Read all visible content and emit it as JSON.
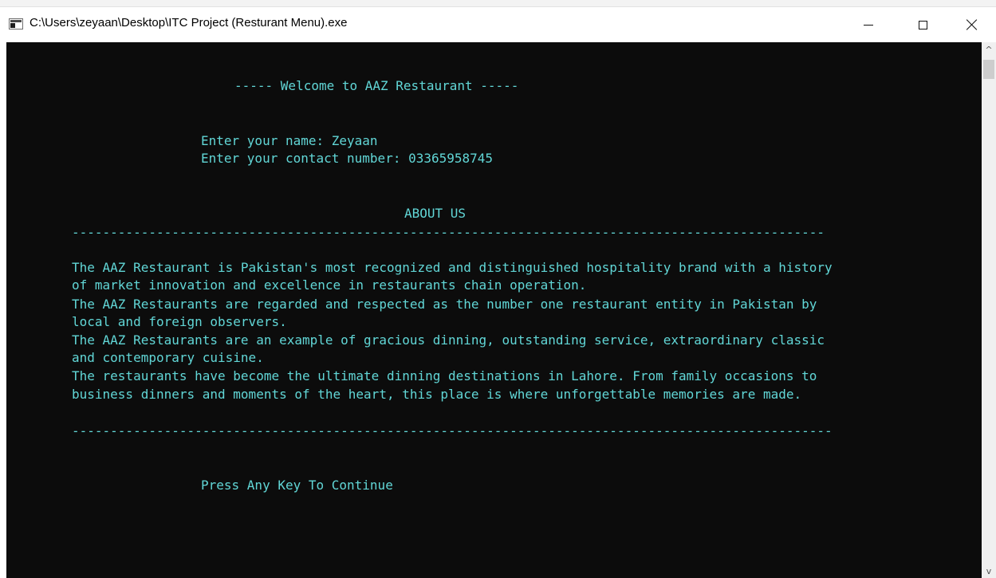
{
  "window": {
    "title": "C:\\Users\\zeyaan\\Desktop\\ITC Project (Resturant Menu).exe"
  },
  "console": {
    "text_color": "#61d6d6",
    "background": "#0c0c0c",
    "welcome": "----- Welcome to AAZ Restaurant -----",
    "name_prompt": "Enter your name: Zeyaan",
    "contact_prompt": "Enter your contact number: 03365958745",
    "about_heading": "ABOUT US",
    "divider_top": "--------------------------------------------------------------------------------------------------",
    "about_lines": [
      "The AAZ Restaurant is Pakistan's most recognized and distinguished hospitality brand with a history",
      "of market innovation and excellence in restaurants chain operation.",
      "The AAZ Restaurants are regarded and respected as the number one restaurant entity in Pakistan by",
      "local and foreign observers.",
      "The AAZ Restaurants are an example of gracious dinning, outstanding service, extraordinary classic",
      "and contemporary cuisine.",
      "The restaurants have become the ultimate dinning destinations in Lahore. From family occasions to",
      "business dinners and moments of the heart, this place is where unforgettable memories are made."
    ],
    "divider_bottom": "---------------------------------------------------------------------------------------------------",
    "continue_prompt": "Press Any Key To Continue"
  },
  "icons": {
    "app": "console-window-icon",
    "minimize": "minimize-icon",
    "maximize": "maximize-icon",
    "close": "close-icon",
    "scroll_up": "chevron-up-icon",
    "scroll_down": "chevron-down-icon"
  },
  "scrollbar": {
    "up_glyph": "^",
    "down_glyph": "v"
  }
}
